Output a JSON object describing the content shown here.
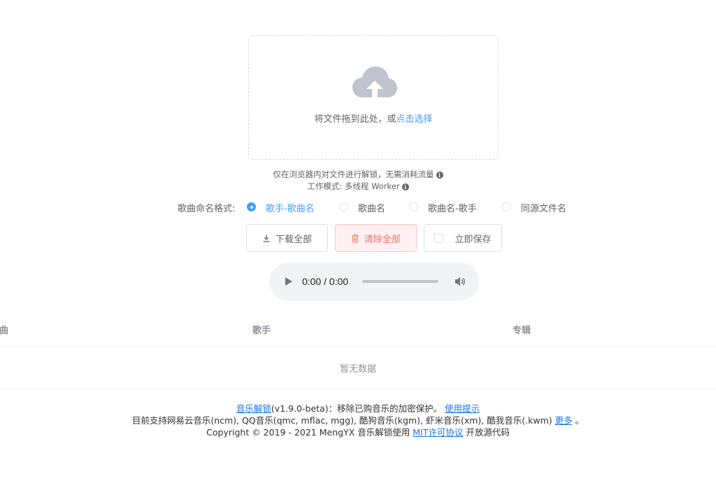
{
  "uploader": {
    "text_prefix": "将文件拖到此处，或",
    "text_link": "点击选择"
  },
  "tips": {
    "line1": "仅在浏览器内对文件进行解锁，无需消耗流量",
    "line2": "工作模式: 多线程 Worker",
    "info_icon": "i"
  },
  "naming": {
    "label": "歌曲命名格式:",
    "options": [
      {
        "label": "歌手-歌曲名",
        "checked": true
      },
      {
        "label": "歌曲名",
        "checked": false
      },
      {
        "label": "歌曲名-歌手",
        "checked": false
      },
      {
        "label": "同源文件名",
        "checked": false
      }
    ]
  },
  "buttons": {
    "download_all": "下载全部",
    "clear_all": "清除全部",
    "save_now": "立即保存"
  },
  "audio": {
    "time": "0:00 / 0:00"
  },
  "table": {
    "headers": [
      "歌曲",
      "歌手",
      "专辑"
    ],
    "empty_text": "暂无数据"
  },
  "footer": {
    "app_link": "音乐解锁",
    "version_text": "(v1.9.0-beta)：移除已购音乐的加密保护。",
    "usage_link": "使用提示",
    "support_text": "目前支持网易云音乐(ncm), QQ音乐(qmc, mflac, mgg), 酷狗音乐(kgm), 虾米音乐(xm), 酷我音乐(.kwm)",
    "more_link": "更多",
    "period": "。",
    "copyright_text": "Copyright © 2019 - 2021 MengYX 音乐解锁使用",
    "license_link": "MIT许可协议",
    "open_source_text": "开放源代码"
  },
  "colors": {
    "primary": "#409eff",
    "danger": "#f56c6c",
    "danger_bg": "#fef0f0",
    "text": "#606266",
    "link": "#1a73e8"
  }
}
